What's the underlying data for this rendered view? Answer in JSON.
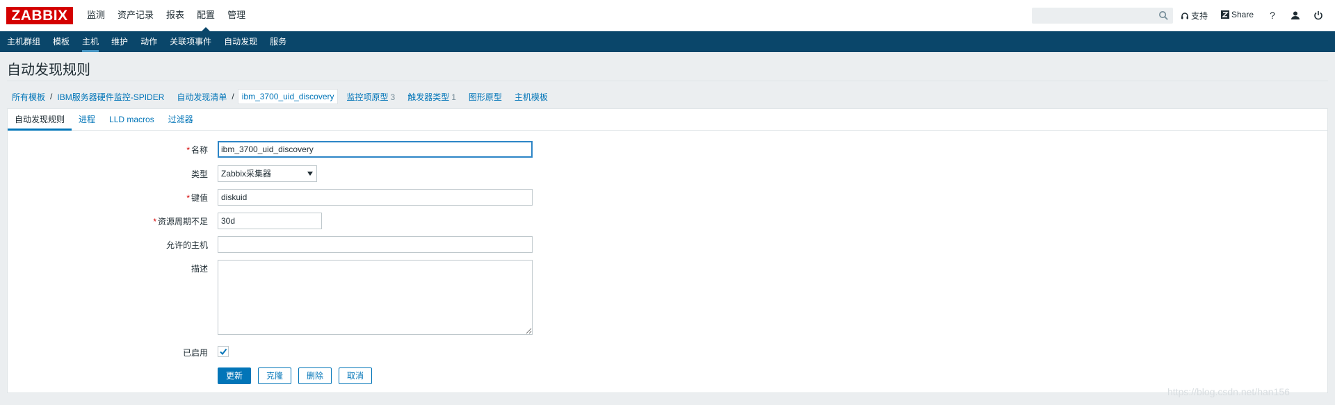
{
  "header": {
    "logo": "ZABBIX",
    "menu": [
      {
        "label": "监测"
      },
      {
        "label": "资产记录"
      },
      {
        "label": "报表"
      },
      {
        "label": "配置",
        "active": true
      },
      {
        "label": "管理"
      }
    ],
    "search": {
      "value": "",
      "placeholder": "",
      "icon": "search-icon"
    },
    "support_label": "支持",
    "share_label": "Share",
    "help_icon": "question-icon",
    "user_icon": "user-icon",
    "logout_icon": "power-icon"
  },
  "submenu": [
    {
      "label": "主机群组"
    },
    {
      "label": "模板"
    },
    {
      "label": "主机",
      "active": true
    },
    {
      "label": "维护"
    },
    {
      "label": "动作"
    },
    {
      "label": "关联项事件"
    },
    {
      "label": "自动发现"
    },
    {
      "label": "服务"
    }
  ],
  "page": {
    "title": "自动发现规则"
  },
  "breadcrumbs": {
    "all_templates": "所有模板",
    "separator": "/",
    "template": "IBM服务器硬件监控-SPIDER",
    "discovery_list": "自动发现清单",
    "current": "ibm_3700_uid_discovery",
    "item_prototypes": {
      "label": "监控项原型",
      "count": "3"
    },
    "trigger_prototypes": {
      "label": "触发器类型",
      "count": "1"
    },
    "graph_prototypes": "图形原型",
    "host_prototypes": "主机模板"
  },
  "tabs": [
    {
      "label": "自动发现规则",
      "active": true
    },
    {
      "label": "进程"
    },
    {
      "label": "LLD macros"
    },
    {
      "label": "过滤器"
    }
  ],
  "form": {
    "required_mark": "*",
    "name": {
      "label": "名称",
      "value": "ibm_3700_uid_discovery"
    },
    "type": {
      "label": "类型",
      "value": "Zabbix采集器"
    },
    "key": {
      "label": "键值",
      "value": "diskuid"
    },
    "lifetime": {
      "label": "资源周期不足",
      "value": "30d"
    },
    "allowed_hosts": {
      "label": "允许的主机",
      "value": ""
    },
    "description": {
      "label": "描述",
      "value": ""
    },
    "enabled": {
      "label": "已启用",
      "checked": true
    }
  },
  "buttons": {
    "update": "更新",
    "clone": "克隆",
    "delete": "删除",
    "cancel": "取消"
  },
  "watermark": "https://blog.csdn.net/han156",
  "colors": {
    "brand_red": "#d40000",
    "nav_blue": "#0a466a",
    "link_blue": "#0275b8"
  }
}
